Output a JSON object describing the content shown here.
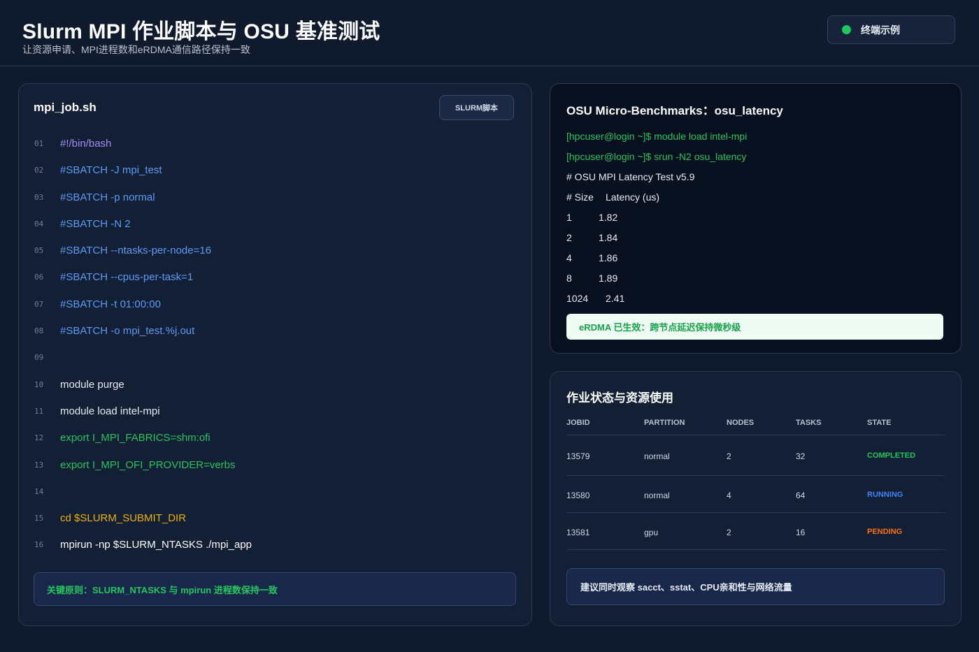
{
  "header": {
    "title": "Slurm MPI 作业脚本与 OSU 基准测试",
    "subtitle": "让资源申请、MPI进程数和eRDMA通信路径保持一致",
    "terminal_button": {
      "label": "终端示例",
      "dot_color": "#22c55e"
    }
  },
  "script_panel": {
    "file_name": "mpi_job.sh",
    "badge": "SLURM脚本",
    "lines": [
      {
        "num": "01",
        "text": "#!/bin/bash",
        "color": "#a78bfa"
      },
      {
        "num": "02",
        "text": "#SBATCH -J mpi_test",
        "color": "#5b9bf5"
      },
      {
        "num": "03",
        "text": "#SBATCH -p normal",
        "color": "#5b9bf5"
      },
      {
        "num": "04",
        "text": "#SBATCH -N 2",
        "color": "#5b9bf5"
      },
      {
        "num": "05",
        "text": "#SBATCH --ntasks-per-node=16",
        "color": "#5b9bf5"
      },
      {
        "num": "06",
        "text": "#SBATCH --cpus-per-task=1",
        "color": "#5b9bf5"
      },
      {
        "num": "07",
        "text": "#SBATCH -t 01:00:00",
        "color": "#5b9bf5"
      },
      {
        "num": "08",
        "text": "#SBATCH -o mpi_test.%j.out",
        "color": "#5b9bf5"
      },
      {
        "num": "09",
        "text": "",
        "color": "#e6ecf5"
      },
      {
        "num": "10",
        "text": "module purge",
        "color": "#e6ecf5"
      },
      {
        "num": "11",
        "text": "module load intel-mpi",
        "color": "#e6ecf5"
      },
      {
        "num": "12",
        "text": "export I_MPI_FABRICS=shm:ofi",
        "color": "#22c55e"
      },
      {
        "num": "13",
        "text": "export I_MPI_OFI_PROVIDER=verbs",
        "color": "#22c55e"
      },
      {
        "num": "14",
        "text": "",
        "color": "#e6ecf5"
      },
      {
        "num": "15",
        "text": "cd $SLURM_SUBMIT_DIR",
        "color": "#eab308"
      },
      {
        "num": "16",
        "text": "mpirun -np $SLURM_NTASKS ./mpi_app",
        "color": "#ffffff"
      }
    ],
    "principle": "关键原则：SLURM_NTASKS 与 mpirun 进程数保持一致"
  },
  "osu_panel": {
    "title": "OSU Micro-Benchmarks：osu_latency",
    "commands": [
      "[hpcuser@login ~]$ module load intel-mpi",
      "[hpcuser@login ~]$ srun -N2 osu_latency"
    ],
    "header_line": "# OSU MPI Latency Test v5.9",
    "col_size": "# Size",
    "col_latency": "Latency (us)",
    "rows": [
      {
        "size": "1",
        "latency": "1.82"
      },
      {
        "size": "2",
        "latency": "1.84"
      },
      {
        "size": "4",
        "latency": "1.86"
      },
      {
        "size": "8",
        "latency": "1.89"
      },
      {
        "size": "1024",
        "latency": "2.41"
      }
    ],
    "status": "eRDMA 已生效：跨节点延迟保持微秒级"
  },
  "jobs_panel": {
    "title": "作业状态与资源使用",
    "columns": [
      "JOBID",
      "PARTITION",
      "NODES",
      "TASKS",
      "STATE"
    ],
    "rows": [
      {
        "jobid": "13579",
        "partition": "normal",
        "nodes": "2",
        "tasks": "32",
        "state": "COMPLETED",
        "state_color": "#22c55e"
      },
      {
        "jobid": "13580",
        "partition": "normal",
        "nodes": "4",
        "tasks": "64",
        "state": "RUNNING",
        "state_color": "#3b82f6"
      },
      {
        "jobid": "13581",
        "partition": "gpu",
        "nodes": "2",
        "tasks": "16",
        "state": "PENDING",
        "state_color": "#f97316"
      }
    ],
    "suggestion": "建议同时观察 sacct、sstat、CPU亲和性与网络流量"
  }
}
